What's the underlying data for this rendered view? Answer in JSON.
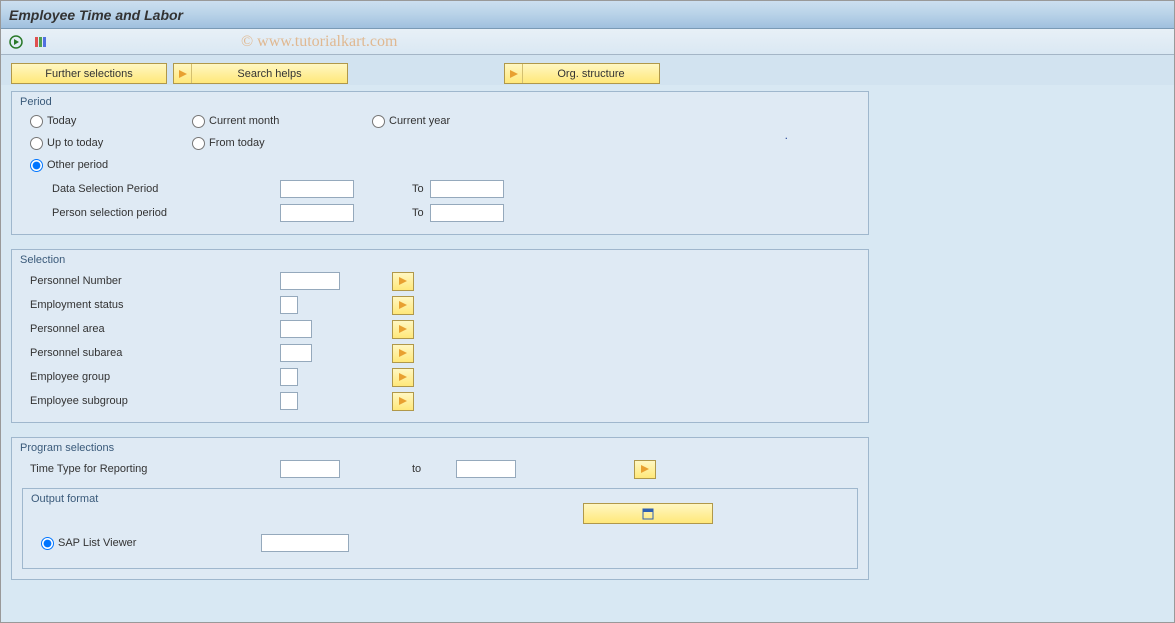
{
  "header": {
    "title": "Employee Time and Labor"
  },
  "watermark": "© www.tutorialkart.com",
  "toolbar_buttons": {
    "further": "Further selections",
    "search": "Search helps",
    "org": "Org. structure"
  },
  "period_group": {
    "title": "Period",
    "radios": {
      "today": "Today",
      "current_month": "Current month",
      "current_year": "Current year",
      "up_to_today": "Up to today",
      "from_today": "From today",
      "other_period": "Other period"
    },
    "data_sel_label": "Data Selection Period",
    "data_sel_from": "",
    "data_sel_to_label": "To",
    "data_sel_to": "",
    "person_sel_label": "Person selection period",
    "person_sel_from": "",
    "person_sel_to_label": "To",
    "person_sel_to": ""
  },
  "selection_group": {
    "title": "Selection",
    "fields": {
      "personnel_number": {
        "label": "Personnel Number",
        "value": ""
      },
      "employment_status": {
        "label": "Employment status",
        "value": ""
      },
      "personnel_area": {
        "label": "Personnel area",
        "value": ""
      },
      "personnel_subarea": {
        "label": "Personnel subarea",
        "value": ""
      },
      "employee_group": {
        "label": "Employee group",
        "value": ""
      },
      "employee_subgroup": {
        "label": "Employee subgroup",
        "value": ""
      }
    }
  },
  "program_group": {
    "title": "Program selections",
    "time_type_label": "Time Type for Reporting",
    "time_type_from": "",
    "to_label": "to",
    "time_type_to": "",
    "output_group": {
      "title": "Output format",
      "sap_list_label": "SAP List Viewer",
      "sap_list_value": ""
    }
  }
}
